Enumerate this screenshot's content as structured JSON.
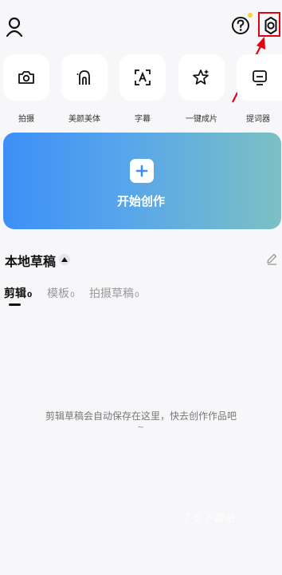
{
  "tools": [
    {
      "label": "拍摄",
      "icon": "camera-icon"
    },
    {
      "label": "美颜美体",
      "icon": "beauty-icon"
    },
    {
      "label": "字幕",
      "icon": "subtitle-icon"
    },
    {
      "label": "一键成片",
      "icon": "magic-icon"
    },
    {
      "label": "提词器",
      "icon": "teleprompter-icon"
    }
  ],
  "create": {
    "label": "开始创作",
    "icon": "plus-icon"
  },
  "drafts": {
    "title": "本地草稿"
  },
  "tabs": [
    {
      "label": "剪辑",
      "count": "0",
      "active": true
    },
    {
      "label": "模板",
      "count": "0",
      "active": false
    },
    {
      "label": "拍摄草稿",
      "count": "0",
      "active": false
    }
  ],
  "empty": {
    "message": "剪辑草稿会自动保存在这里，快去创作作品吧",
    "tilde": "~"
  },
  "watermark": {
    "text": "7る下載站"
  },
  "colors": {
    "accent": "#3d8ff8",
    "highlight": "#e60012",
    "notification": "#ffcf33"
  }
}
